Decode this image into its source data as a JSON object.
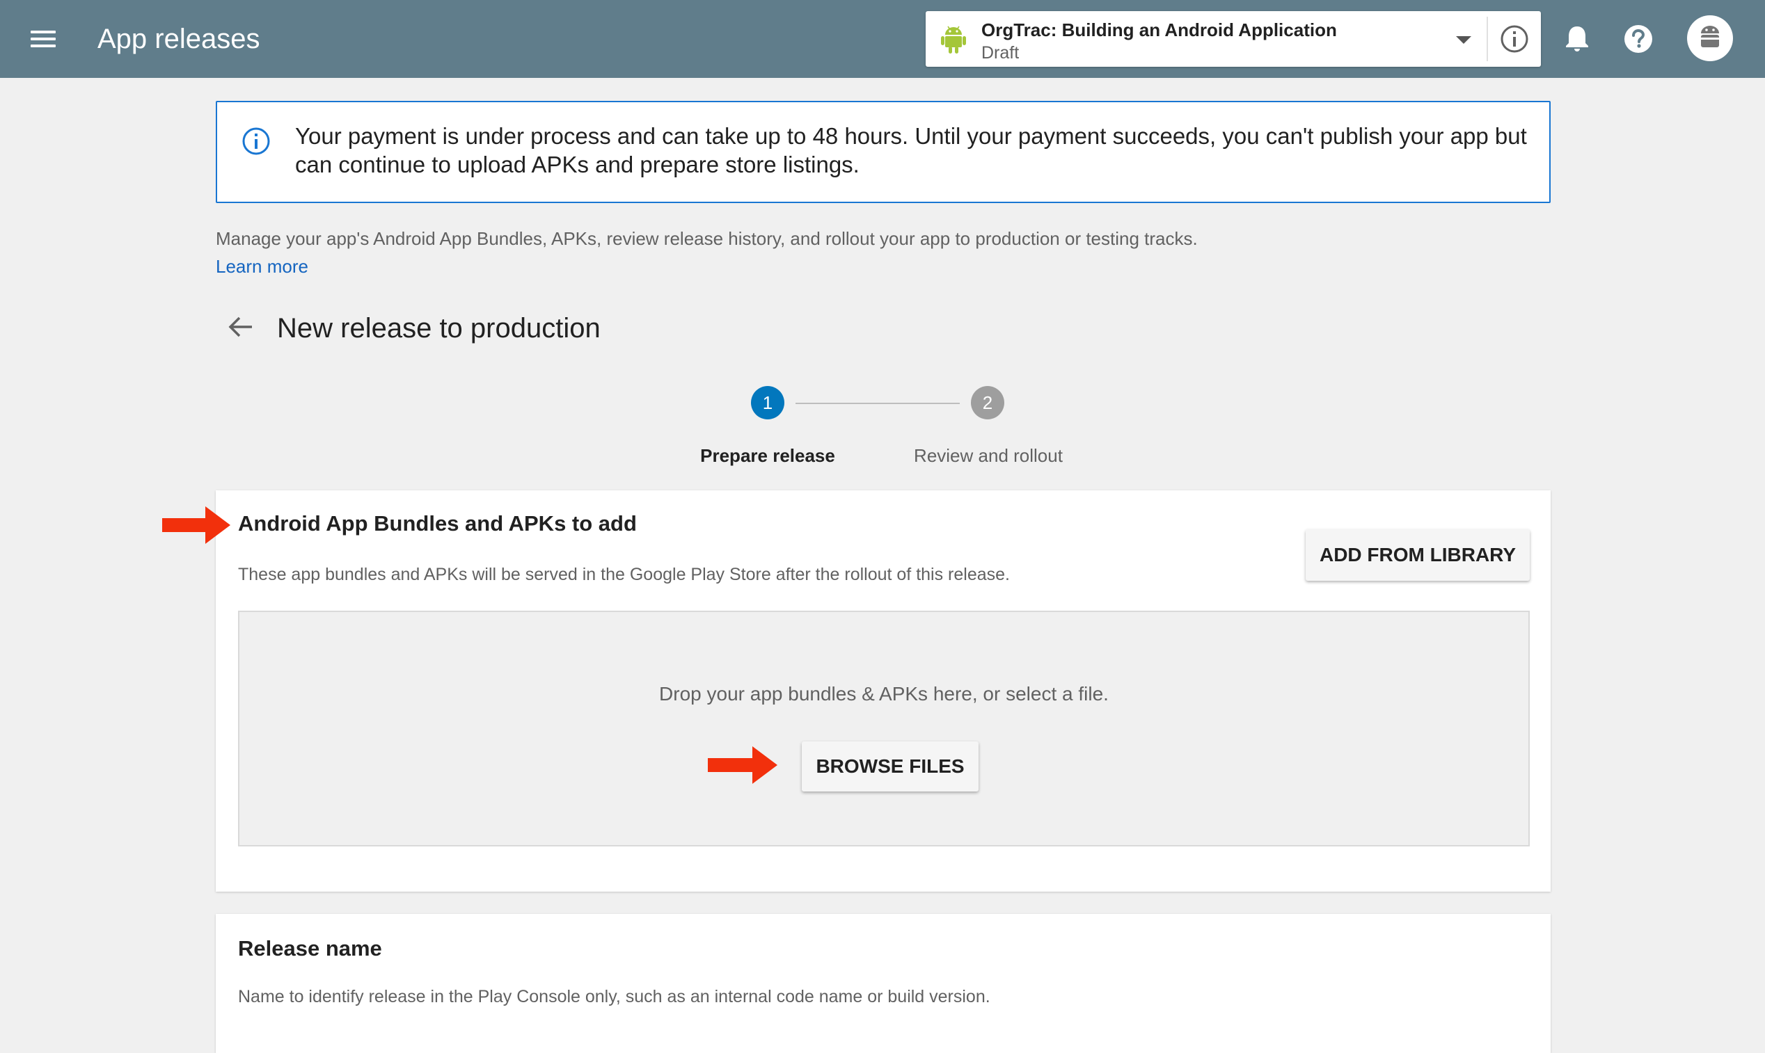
{
  "header": {
    "title": "App releases",
    "app_selector": {
      "app_name": "OrgTrac: Building an Android Application",
      "status": "Draft"
    }
  },
  "banner": {
    "message": "Your payment is under process and can take up to 48 hours. Until your payment succeeds, you can't publish your app but can continue to upload APKs and prepare store listings."
  },
  "intro": {
    "text": "Manage your app's Android App Bundles, APKs, review release history, and rollout your app to production or testing tracks.",
    "learn_more": "Learn more"
  },
  "page": {
    "title": "New release to production"
  },
  "stepper": {
    "steps": [
      {
        "number": "1",
        "label": "Prepare release",
        "active": true
      },
      {
        "number": "2",
        "label": "Review and rollout",
        "active": false
      }
    ]
  },
  "bundles_card": {
    "title": "Android App Bundles and APKs to add",
    "description": "These app bundles and APKs will be served in the Google Play Store after the rollout of this release.",
    "add_from_library": "ADD FROM LIBRARY",
    "drop_text": "Drop your app bundles & APKs here, or select a file.",
    "browse_files": "BROWSE FILES"
  },
  "release_name_card": {
    "title": "Release name",
    "description": "Name to identify release in the Play Console only, such as an internal code name or build version."
  },
  "colors": {
    "topbar": "#607d8b",
    "accent_blue": "#0277bd",
    "annotation_red": "#f2300c",
    "android_green": "#a4c639"
  },
  "icons": [
    "menu-icon",
    "android-icon",
    "chevron-down-icon",
    "info-icon",
    "bell-icon",
    "help-icon",
    "avatar-icon",
    "back-arrow-icon",
    "annotation-arrow-icon"
  ]
}
